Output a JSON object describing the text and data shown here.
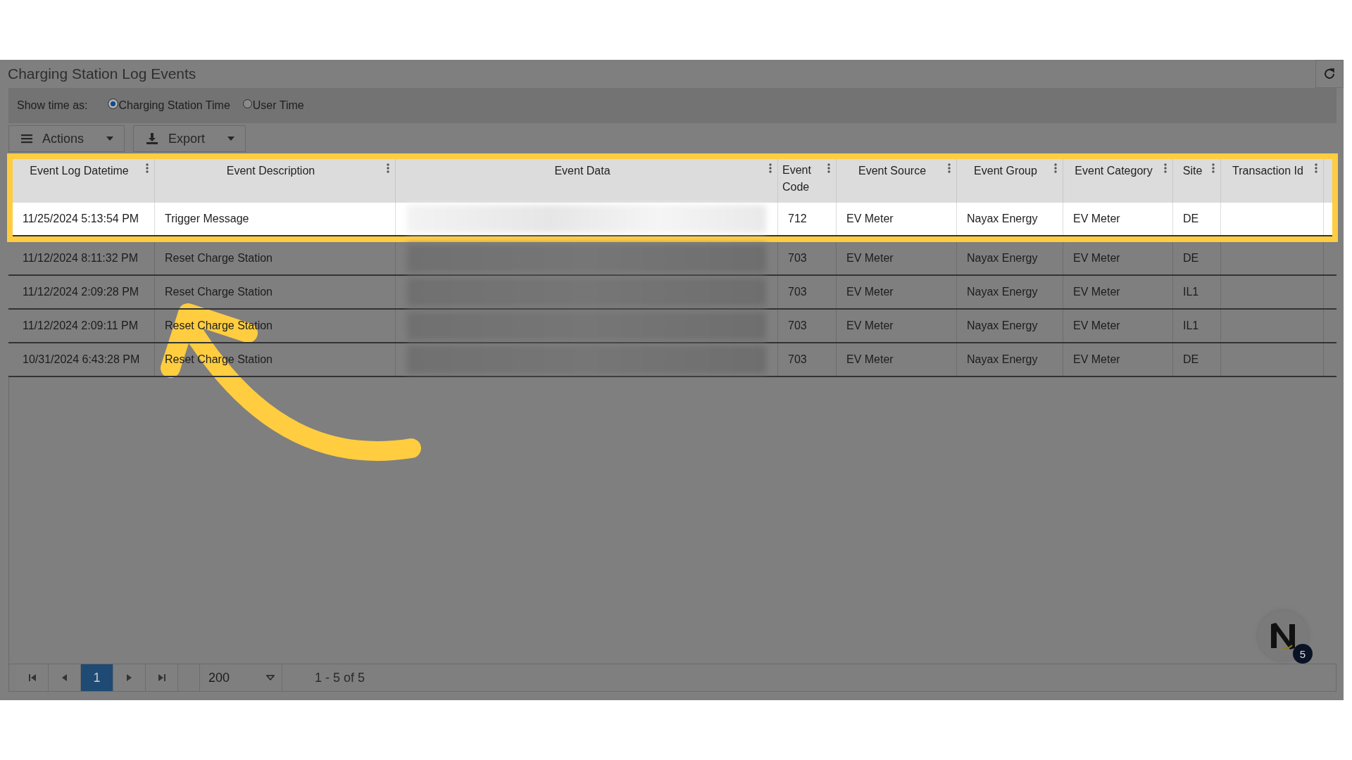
{
  "page": {
    "title": "Charging Station Log Events"
  },
  "time_filter": {
    "label": "Show time as:",
    "options": [
      {
        "label": "Charging Station Time",
        "selected": true
      },
      {
        "label": "User Time",
        "selected": false
      }
    ]
  },
  "toolbar": [
    {
      "label": "Actions",
      "kind": "menu"
    },
    {
      "label": "Export",
      "kind": "download"
    }
  ],
  "table": {
    "columns": [
      "Event Log Datetime",
      "Event Description",
      "Event Data",
      "Event Code",
      "Event Source",
      "Event Group",
      "Event Category",
      "Site",
      "Transaction Id"
    ],
    "rows": [
      {
        "highlighted": true,
        "datetime": "11/25/2024 5:13:54 PM",
        "description": "Trigger Message",
        "code": "712",
        "source": "EV Meter",
        "group": "Nayax Energy",
        "category": "EV Meter",
        "site": "DE"
      },
      {
        "highlighted": false,
        "datetime": "11/12/2024 8:11:32 PM",
        "description": "Reset Charge Station",
        "code": "703",
        "source": "EV Meter",
        "group": "Nayax Energy",
        "category": "EV Meter",
        "site": "DE"
      },
      {
        "highlighted": false,
        "datetime": "11/12/2024 2:09:28 PM",
        "description": "Reset Charge Station",
        "code": "703",
        "source": "EV Meter",
        "group": "Nayax Energy",
        "category": "EV Meter",
        "site": "IL1"
      },
      {
        "highlighted": false,
        "datetime": "11/12/2024 2:09:11 PM",
        "description": "Reset Charge Station",
        "code": "703",
        "source": "EV Meter",
        "group": "Nayax Energy",
        "category": "EV Meter",
        "site": "IL1"
      },
      {
        "highlighted": false,
        "datetime": "10/31/2024 6:43:28 PM",
        "description": "Reset Charge Station",
        "code": "703",
        "source": "EV Meter",
        "group": "Nayax Energy",
        "category": "EV Meter",
        "site": "DE"
      }
    ]
  },
  "pager": {
    "pages": [
      {
        "label": "1",
        "selected": true
      }
    ],
    "page_size": "200",
    "summary": "1 - 5 of 5"
  },
  "chat_badge": "5"
}
